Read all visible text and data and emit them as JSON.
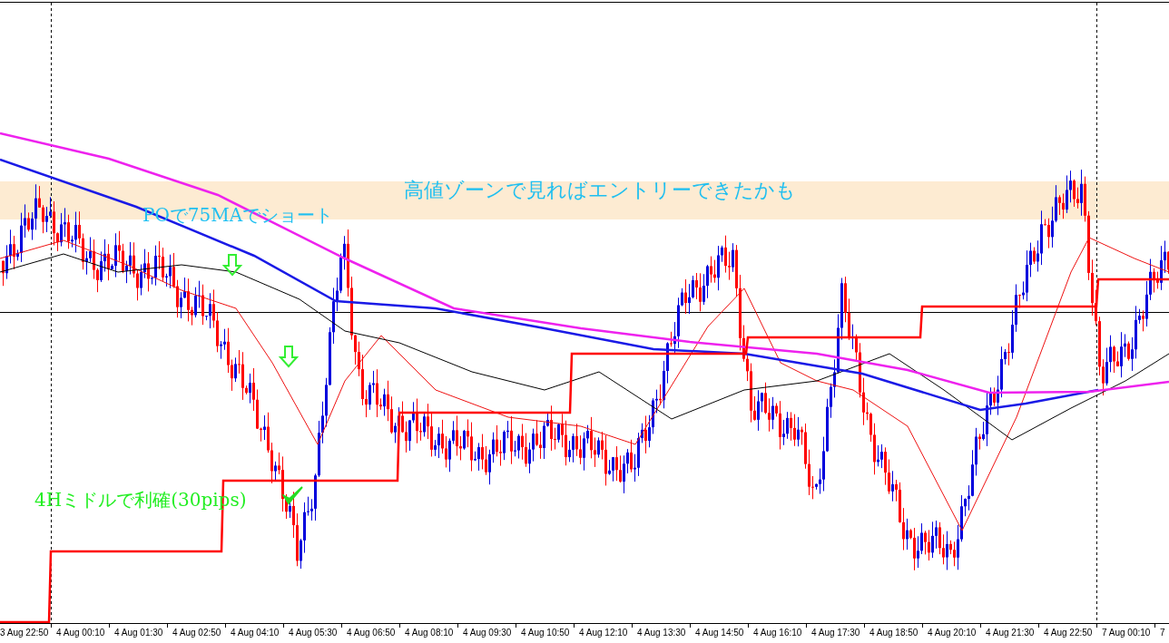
{
  "annotations": [
    {
      "kind": "zone-note",
      "text": "高値ゾーンで見ればエントリーできたかも"
    },
    {
      "kind": "entry-note",
      "text": "POで75MAでショート"
    },
    {
      "kind": "exit-note",
      "text": "4Hミドルで利確(30pips)"
    }
  ],
  "time_axis": {
    "labels": [
      "3 Aug 22:50",
      "4 Aug 00:10",
      "4 Aug 01:30",
      "4 Aug 02:50",
      "4 Aug 04:10",
      "4 Aug 05:30",
      "4 Aug 06:50",
      "4 Aug 08:10",
      "4 Aug 09:30",
      "4 Aug 10:50",
      "4 Aug 12:10",
      "4 Aug 13:30",
      "4 Aug 14:50",
      "4 Aug 16:10",
      "4 Aug 17:30",
      "4 Aug 18:50",
      "4 Aug 20:10",
      "4 Aug 21:30",
      "4 Aug 22:50",
      "7 Aug 00:10",
      "7"
    ]
  }
}
